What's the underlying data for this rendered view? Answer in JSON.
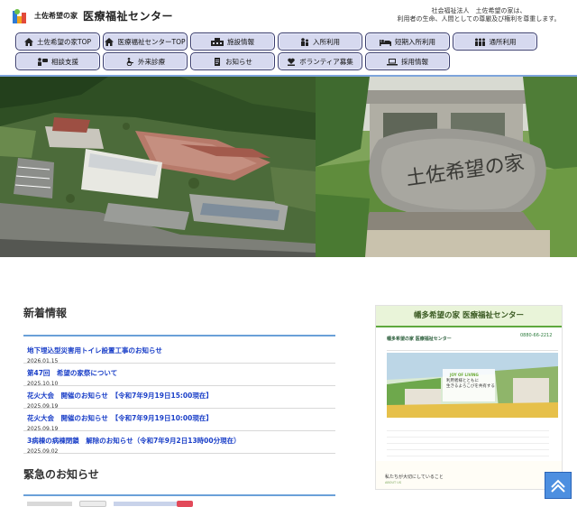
{
  "header": {
    "logo_small": "土佐希望の家",
    "logo_big": "医療福祉センター",
    "tagline_line1": "社会福祉法人　土佐希望の家は、",
    "tagline_line2": "利用者の生命、人間としての尊厳及び権利を尊重します。"
  },
  "nav": [
    {
      "label": "土佐希望の家TOP",
      "icon": "home-icon"
    },
    {
      "label": "医療福祉センターTOP",
      "icon": "home-icon"
    },
    {
      "label": "施設情報",
      "icon": "building-icon"
    },
    {
      "label": "入所利用",
      "icon": "people-icon"
    },
    {
      "label": "短期入所利用",
      "icon": "bed-icon"
    },
    {
      "label": "通所利用",
      "icon": "people-group-icon"
    },
    {
      "label": "相談支援",
      "icon": "consult-icon"
    },
    {
      "label": "外来診療",
      "icon": "wheelchair-icon"
    },
    {
      "label": "お知らせ",
      "icon": "document-icon"
    },
    {
      "label": "ボランティア募集",
      "icon": "heart-hand-icon"
    },
    {
      "label": "採用情報",
      "icon": "laptop-icon"
    }
  ],
  "hero": {
    "stone_text": "土佐希望の家"
  },
  "news": {
    "title": "新着情報",
    "items": [
      {
        "title": "地下埋込型災害用トイレ設置工事のお知らせ",
        "date": "2026.01.15"
      },
      {
        "title": "第47回　希望の家祭について",
        "date": "2025.10.10"
      },
      {
        "title": "花火大会　開催のお知らせ　【令和7年9月19日15:00現在】",
        "date": "2025.09.19"
      },
      {
        "title": "花火大会　開催のお知らせ　【令和7年9月19日10:00現在】",
        "date": "2025.09.19"
      },
      {
        "title": "3病棟の病棟閉鎖　解除のお知らせ（令和7年9月2日13時00分現在）",
        "date": "2025.09.02"
      }
    ]
  },
  "urgent": {
    "title": "緊急のお知らせ"
  },
  "banner": {
    "title": "幡多希望の家 医療福祉センター",
    "site_name": "幡多希望の家 医療福祉センター",
    "tel": "0880-66-2212",
    "joy": "JOY OF LIVING",
    "copy1": "利用者様とともに",
    "copy2": "生きるよろこびを共有する",
    "foot_text": "私たちが大切にしていること",
    "foot_sub": "ABOUT US"
  },
  "colors": {
    "nav_bg": "#d6d9ef",
    "nav_border": "#3a3d6e",
    "accent_blue": "#6aa0d8",
    "link_blue": "#1a3fc8",
    "banner_green": "#5ea83d",
    "pagetop_blue": "#4d8fe0"
  }
}
